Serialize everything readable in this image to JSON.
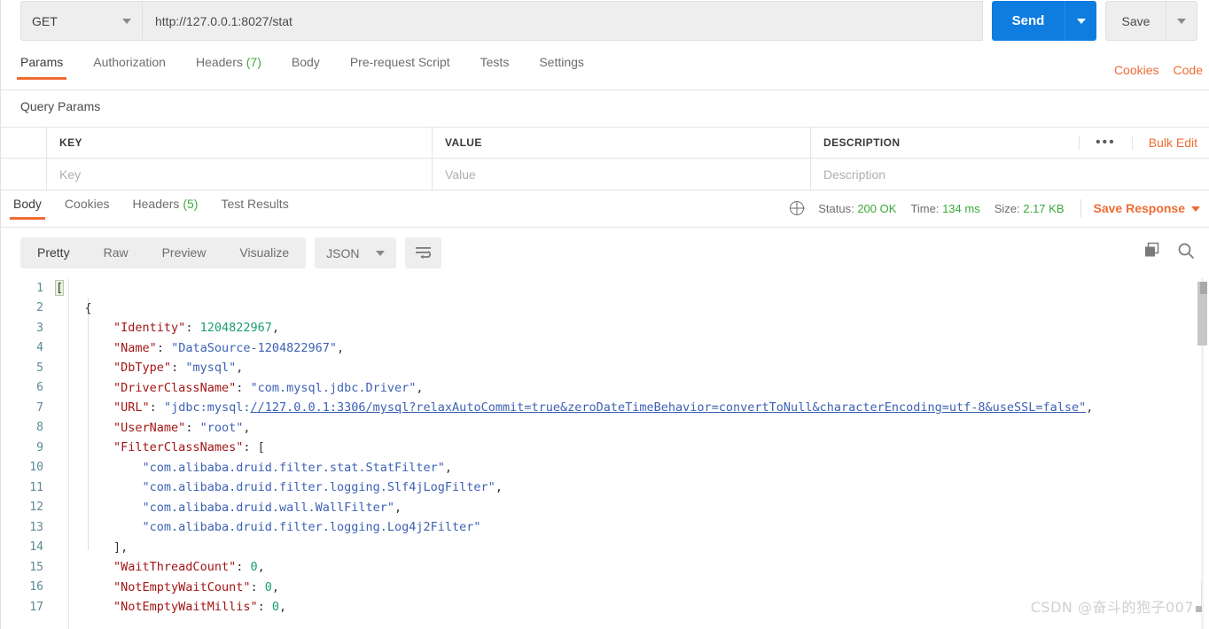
{
  "request": {
    "method": "GET",
    "url": "http://127.0.0.1:8027/stat",
    "send_label": "Send",
    "save_label": "Save"
  },
  "request_tabs": [
    {
      "label": "Params",
      "badge": "",
      "active": true
    },
    {
      "label": "Authorization",
      "badge": "",
      "active": false
    },
    {
      "label": "Headers",
      "badge": "(7)",
      "active": false
    },
    {
      "label": "Body",
      "badge": "",
      "active": false
    },
    {
      "label": "Pre-request Script",
      "badge": "",
      "active": false
    },
    {
      "label": "Tests",
      "badge": "",
      "active": false
    },
    {
      "label": "Settings",
      "badge": "",
      "active": false
    }
  ],
  "request_links": {
    "cookies": "Cookies",
    "code": "Code"
  },
  "query_params": {
    "title": "Query Params",
    "headers": [
      "KEY",
      "VALUE",
      "DESCRIPTION"
    ],
    "row_placeholders": [
      "Key",
      "Value",
      "Description"
    ],
    "more_dots": "•••",
    "bulk_edit": "Bulk Edit"
  },
  "response_tabs": [
    {
      "label": "Body",
      "badge": "",
      "active": true
    },
    {
      "label": "Cookies",
      "badge": "",
      "active": false
    },
    {
      "label": "Headers",
      "badge": "(5)",
      "active": false
    },
    {
      "label": "Test Results",
      "badge": "",
      "active": false
    }
  ],
  "response_meta": {
    "status_label": "Status:",
    "status_value": "200 OK",
    "time_label": "Time:",
    "time_value": "134 ms",
    "size_label": "Size:",
    "size_value": "2.17 KB",
    "save_response": "Save Response"
  },
  "body_toolbar": {
    "views": [
      "Pretty",
      "Raw",
      "Preview",
      "Visualize"
    ],
    "active_view": "Pretty",
    "format": "JSON"
  },
  "colors": {
    "accent_orange": "#ef6c33",
    "send_blue": "#0f7de0",
    "status_green": "#3aa83a"
  },
  "watermark": "CSDN @奋斗的狍子007",
  "code": {
    "lines": [
      {
        "n": 1,
        "tokens": [
          {
            "t": "[",
            "c": "k-punct bracket-hl"
          }
        ]
      },
      {
        "n": 2,
        "tokens": [
          {
            "t": "    {",
            "c": "k-punct"
          }
        ]
      },
      {
        "n": 3,
        "tokens": [
          {
            "t": "        ",
            "c": "k-punct"
          },
          {
            "t": "\"Identity\"",
            "c": "k-key"
          },
          {
            "t": ": ",
            "c": "k-punct"
          },
          {
            "t": "1204822967",
            "c": "k-num"
          },
          {
            "t": ",",
            "c": "k-punct"
          }
        ]
      },
      {
        "n": 4,
        "tokens": [
          {
            "t": "        ",
            "c": "k-punct"
          },
          {
            "t": "\"Name\"",
            "c": "k-key"
          },
          {
            "t": ": ",
            "c": "k-punct"
          },
          {
            "t": "\"DataSource-1204822967\"",
            "c": "k-str"
          },
          {
            "t": ",",
            "c": "k-punct"
          }
        ]
      },
      {
        "n": 5,
        "tokens": [
          {
            "t": "        ",
            "c": "k-punct"
          },
          {
            "t": "\"DbType\"",
            "c": "k-key"
          },
          {
            "t": ": ",
            "c": "k-punct"
          },
          {
            "t": "\"mysql\"",
            "c": "k-str"
          },
          {
            "t": ",",
            "c": "k-punct"
          }
        ]
      },
      {
        "n": 6,
        "tokens": [
          {
            "t": "        ",
            "c": "k-punct"
          },
          {
            "t": "\"DriverClassName\"",
            "c": "k-key"
          },
          {
            "t": ": ",
            "c": "k-punct"
          },
          {
            "t": "\"com.mysql.jdbc.Driver\"",
            "c": "k-str"
          },
          {
            "t": ",",
            "c": "k-punct"
          }
        ]
      },
      {
        "n": 7,
        "tokens": [
          {
            "t": "        ",
            "c": "k-punct"
          },
          {
            "t": "\"URL\"",
            "c": "k-key"
          },
          {
            "t": ": ",
            "c": "k-punct"
          },
          {
            "t": "\"jdbc:mysql:",
            "c": "k-str"
          },
          {
            "t": "//127.0.0.1:3306/mysql?relaxAutoCommit=true&zeroDateTimeBehavior=convertToNull&characterEncoding=utf-8&useSSL=false\"",
            "c": "k-url"
          },
          {
            "t": ",",
            "c": "k-punct"
          }
        ]
      },
      {
        "n": 8,
        "tokens": [
          {
            "t": "        ",
            "c": "k-punct"
          },
          {
            "t": "\"UserName\"",
            "c": "k-key"
          },
          {
            "t": ": ",
            "c": "k-punct"
          },
          {
            "t": "\"root\"",
            "c": "k-str"
          },
          {
            "t": ",",
            "c": "k-punct"
          }
        ]
      },
      {
        "n": 9,
        "tokens": [
          {
            "t": "        ",
            "c": "k-punct"
          },
          {
            "t": "\"FilterClassNames\"",
            "c": "k-key"
          },
          {
            "t": ": ",
            "c": "k-punct"
          },
          {
            "t": "[",
            "c": "k-punct"
          }
        ]
      },
      {
        "n": 10,
        "tokens": [
          {
            "t": "            ",
            "c": "k-punct"
          },
          {
            "t": "\"com.alibaba.druid.filter.stat.StatFilter\"",
            "c": "k-str"
          },
          {
            "t": ",",
            "c": "k-punct"
          }
        ]
      },
      {
        "n": 11,
        "tokens": [
          {
            "t": "            ",
            "c": "k-punct"
          },
          {
            "t": "\"com.alibaba.druid.filter.logging.Slf4jLogFilter\"",
            "c": "k-str"
          },
          {
            "t": ",",
            "c": "k-punct"
          }
        ]
      },
      {
        "n": 12,
        "tokens": [
          {
            "t": "            ",
            "c": "k-punct"
          },
          {
            "t": "\"com.alibaba.druid.wall.WallFilter\"",
            "c": "k-str"
          },
          {
            "t": ",",
            "c": "k-punct"
          }
        ]
      },
      {
        "n": 13,
        "tokens": [
          {
            "t": "            ",
            "c": "k-punct"
          },
          {
            "t": "\"com.alibaba.druid.filter.logging.Log4j2Filter\"",
            "c": "k-str"
          }
        ]
      },
      {
        "n": 14,
        "tokens": [
          {
            "t": "        ],",
            "c": "k-punct"
          }
        ]
      },
      {
        "n": 15,
        "tokens": [
          {
            "t": "        ",
            "c": "k-punct"
          },
          {
            "t": "\"WaitThreadCount\"",
            "c": "k-key"
          },
          {
            "t": ": ",
            "c": "k-punct"
          },
          {
            "t": "0",
            "c": "k-num"
          },
          {
            "t": ",",
            "c": "k-punct"
          }
        ]
      },
      {
        "n": 16,
        "tokens": [
          {
            "t": "        ",
            "c": "k-punct"
          },
          {
            "t": "\"NotEmptyWaitCount\"",
            "c": "k-key"
          },
          {
            "t": ": ",
            "c": "k-punct"
          },
          {
            "t": "0",
            "c": "k-num"
          },
          {
            "t": ",",
            "c": "k-punct"
          }
        ]
      },
      {
        "n": 17,
        "tokens": [
          {
            "t": "        ",
            "c": "k-punct"
          },
          {
            "t": "\"NotEmptyWaitMillis\"",
            "c": "k-key"
          },
          {
            "t": ": ",
            "c": "k-punct"
          },
          {
            "t": "0",
            "c": "k-num"
          },
          {
            "t": ",",
            "c": "k-punct"
          }
        ]
      }
    ]
  }
}
